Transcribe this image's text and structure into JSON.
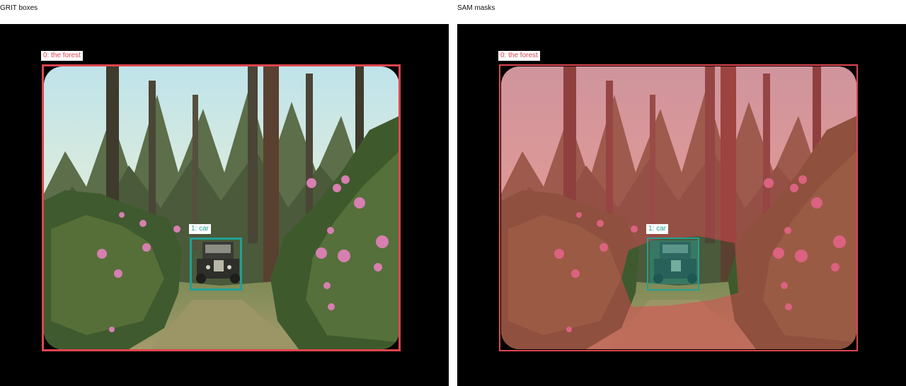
{
  "panels": [
    {
      "title": "GRIT boxes",
      "boxes": [
        {
          "label": "0: the forest",
          "color": "#e0454f"
        },
        {
          "label": "1: car",
          "color": "#22a095"
        }
      ]
    },
    {
      "title": "SAM masks",
      "boxes": [
        {
          "label": "0: the forest",
          "color": "#e0454f"
        },
        {
          "label": "1: car",
          "color": "#22a095"
        }
      ],
      "masks": [
        {
          "name": "forest-mask",
          "color": "#e0454f"
        },
        {
          "name": "car-mask",
          "color": "#22a095"
        }
      ]
    }
  ]
}
